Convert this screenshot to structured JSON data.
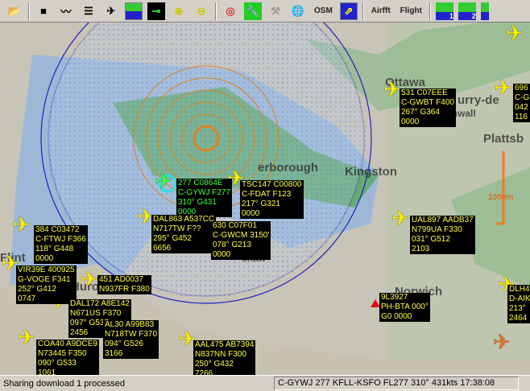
{
  "toolbar": {
    "osm": "OSM",
    "aircraft": "Airfft",
    "flight": "Flight",
    "layer1": "1",
    "layer2": "2"
  },
  "map": {
    "places": [
      "Ottawa",
      "urry-de",
      "Cornwall",
      "Plattsb",
      "erborough",
      "Kingston",
      "Huron",
      "Flint",
      "Norwich",
      "shaw"
    ],
    "scale": "100nm",
    "aircraft": [
      {
        "lines": [
          "277 C0864E",
          "C-GYWJ F277",
          "310° G431",
          "0000"
        ],
        "selected": true
      },
      {
        "lines": [
          "TSC147 C00800",
          "C-FDAT F123",
          "217° G321",
          "0000"
        ]
      },
      {
        "lines": [
          "DAL863 A537CC",
          "N717TW F??",
          "295° G452",
          "6656"
        ]
      },
      {
        "lines": [
          "630 C07F01",
          "C-GWCM 3150'",
          "078° G213",
          "0000"
        ]
      },
      {
        "lines": [
          "384 C03472",
          "C-FTWJ F366",
          "118° G448",
          "0000"
        ]
      },
      {
        "lines": [
          "VIR39E 400925",
          "G-VOGE F341",
          "252° G412",
          "0747"
        ]
      },
      {
        "lines": [
          "451 AD0037",
          "N937FR F380"
        ]
      },
      {
        "lines": [
          "DAL172 A8E142",
          "N671US F370",
          "097° G537",
          "2456"
        ]
      },
      {
        "lines": [
          "AL30 A99B83",
          "N718TW F370",
          "094° G526",
          "3166"
        ]
      },
      {
        "lines": [
          "COA40 A9DCE9",
          "N73445 F350",
          "090° G533",
          "1061"
        ]
      },
      {
        "lines": [
          "AAL475 AB7394",
          "N837NN F300",
          "250° G432",
          "7266"
        ]
      },
      {
        "lines": [
          "531 C07EEE",
          "C-GWBT F400",
          "267° G364",
          "0000"
        ]
      },
      {
        "lines": [
          "696",
          "C-G",
          "042",
          "116"
        ]
      },
      {
        "lines": [
          "UAL897 AADB37",
          "N799UA F330",
          "031° G512",
          "2103"
        ]
      },
      {
        "lines": [
          "9L3927",
          "PH-BTA 000°",
          "G0 0000"
        ]
      },
      {
        "lines": [
          "DLH4",
          "D-AIK",
          "213°",
          "2464"
        ]
      }
    ]
  },
  "status": {
    "left": "Sharing download 1 processed",
    "right": "C-GYWJ 277  KFLL-KSFO FL277 310° 431kts 17:38:08"
  },
  "colors": {
    "label_bg": "#000000",
    "label_text": "#ffff40",
    "selected_text": "#40ff40",
    "range_ring": "#2020c0",
    "orange_ring": "#e08020"
  }
}
